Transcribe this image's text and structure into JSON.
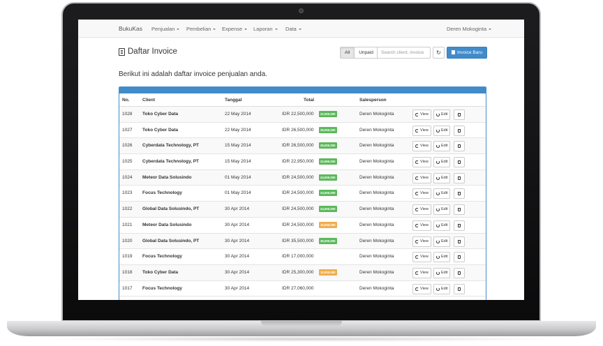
{
  "navbar": {
    "brand": "BukuKas",
    "items": [
      {
        "label": "Penjualan"
      },
      {
        "label": "Pembelian"
      },
      {
        "label": "Expense"
      },
      {
        "label": "Laporan"
      },
      {
        "label": "Data"
      }
    ],
    "user": "Deren Mokoginta"
  },
  "header": {
    "title": "Daftar Invoice",
    "filters": [
      {
        "label": "All",
        "active": true
      },
      {
        "label": "Unpaid",
        "active": false
      }
    ],
    "search_placeholder": "Search client, invoice",
    "new_invoice_label": "Invoice Baru"
  },
  "intro": "Berikut ini adalah daftar invoice penjualan anda.",
  "table": {
    "columns": [
      "No.",
      "Client",
      "Tanggal",
      "Total",
      "Salesperson"
    ],
    "row_actions": {
      "view": "View",
      "edit": "Edit"
    },
    "rows": [
      {
        "no": "1028",
        "client": "Toko Cyber Data",
        "date": "22 May 2014",
        "total": "IDR 22,500,000",
        "badge": "22,000,000",
        "badge_color": "#5cb85c",
        "salesperson": "Deren Mokoginta"
      },
      {
        "no": "1027",
        "client": "Toko Cyber Data",
        "date": "22 May 2014",
        "total": "IDR 26,500,000",
        "badge": "26,000,000",
        "badge_color": "#5cb85c",
        "salesperson": "Deren Mokoginta"
      },
      {
        "no": "1026",
        "client": "Cyberdata Technology, PT",
        "date": "15 May 2014",
        "total": "IDR 26,500,000",
        "badge": "26,000,000",
        "badge_color": "#5cb85c",
        "salesperson": "Deren Mokoginta"
      },
      {
        "no": "1025",
        "client": "Cyberdata Technology, PT",
        "date": "15 May 2014",
        "total": "IDR 22,950,000",
        "badge": "22,950,000",
        "badge_color": "#5cb85c",
        "salesperson": "Deren Mokoginta"
      },
      {
        "no": "1024",
        "client": "Meteor Data Solusindo",
        "date": "01 May 2014",
        "total": "IDR 24,500,000",
        "badge": "24,000,000",
        "badge_color": "#5cb85c",
        "salesperson": "Deren Mokoginta"
      },
      {
        "no": "1023",
        "client": "Focus Technology",
        "date": "01 May 2014",
        "total": "IDR 24,500,000",
        "badge": "24,500,000",
        "badge_color": "#5cb85c",
        "salesperson": "Deren Mokoginta"
      },
      {
        "no": "1022",
        "client": "Global Data Solusindo, PT",
        "date": "30 Apr 2014",
        "total": "IDR 24,500,000",
        "badge": "24,000,000",
        "badge_color": "#5cb85c",
        "salesperson": "Deren Mokoginta"
      },
      {
        "no": "1021",
        "client": "Meteor Data Solusindo",
        "date": "30 Apr 2014",
        "total": "IDR 24,500,000",
        "badge": "10,000,000",
        "badge_color": "#f0ad4e",
        "salesperson": "Deren Mokoginta"
      },
      {
        "no": "1020",
        "client": "Global Data Solusindo, PT",
        "date": "30 Apr 2014",
        "total": "IDR 35,500,000",
        "badge": "35,000,000",
        "badge_color": "#5cb85c",
        "salesperson": "Deren Mokoginta"
      },
      {
        "no": "1019",
        "client": "Focus Technology",
        "date": "30 Apr 2014",
        "total": "IDR 17,000,000",
        "badge": "",
        "badge_color": "",
        "salesperson": "Deren Mokoginta"
      },
      {
        "no": "1018",
        "client": "Toko Cyber Data",
        "date": "30 Apr 2014",
        "total": "IDR 25,300,000",
        "badge": "10,000,000",
        "badge_color": "#f0ad4e",
        "salesperson": "Deren Mokoginta"
      },
      {
        "no": "1017",
        "client": "Focus Technology",
        "date": "30 Apr 2014",
        "total": "IDR 27,060,000",
        "badge": "",
        "badge_color": "",
        "salesperson": "Deren Mokoginta"
      }
    ]
  }
}
